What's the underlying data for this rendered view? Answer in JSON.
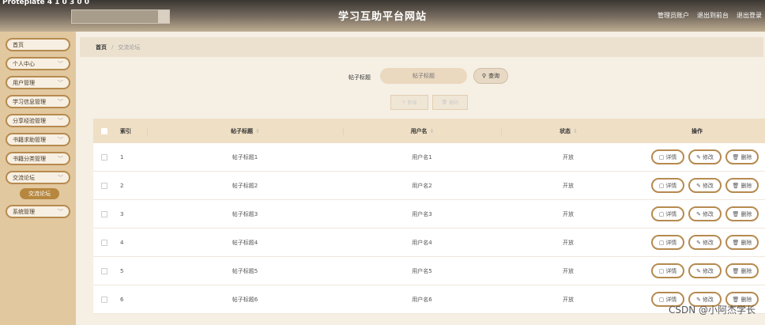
{
  "header": {
    "logo_text": "Proteplate 4 1 0 3 0 0",
    "site_title": "学习互助平台网站",
    "links": [
      "管理员账户",
      "退出到前台",
      "退出登录"
    ]
  },
  "sidebar": {
    "items": [
      {
        "label": "首页",
        "has_chevron": false
      },
      {
        "label": "个人中心",
        "has_chevron": true
      },
      {
        "label": "用户管理",
        "has_chevron": true
      },
      {
        "label": "学习信息管理",
        "has_chevron": true
      },
      {
        "label": "分享经验管理",
        "has_chevron": true
      },
      {
        "label": "书籍求助管理",
        "has_chevron": true
      },
      {
        "label": "书籍分类管理",
        "has_chevron": true
      },
      {
        "label": "交流论坛",
        "has_chevron": true
      },
      {
        "label": "系统管理",
        "has_chevron": true
      }
    ],
    "sub_item": "交流论坛"
  },
  "breadcrumb": {
    "home": "首页",
    "sep": "/",
    "current": "交流论坛"
  },
  "filter": {
    "label": "帖子标题",
    "placeholder": "帖子标题",
    "query_label": "查询",
    "add_label": "新增",
    "delete_label": "删除"
  },
  "table": {
    "headers": {
      "index": "索引",
      "title": "帖子标题",
      "user": "用户名",
      "status": "状态",
      "ops": "操作"
    },
    "ops": {
      "detail": "详情",
      "edit": "修改",
      "delete": "删除"
    },
    "rows": [
      {
        "index": "1",
        "title": "帖子标题1",
        "user": "用户名1",
        "status": "开放"
      },
      {
        "index": "2",
        "title": "帖子标题2",
        "user": "用户名2",
        "status": "开放"
      },
      {
        "index": "3",
        "title": "帖子标题3",
        "user": "用户名3",
        "status": "开放"
      },
      {
        "index": "4",
        "title": "帖子标题4",
        "user": "用户名4",
        "status": "开放"
      },
      {
        "index": "5",
        "title": "帖子标题5",
        "user": "用户名5",
        "status": "开放"
      },
      {
        "index": "6",
        "title": "帖子标题6",
        "user": "用户名6",
        "status": "开放"
      }
    ]
  },
  "watermark": "CSDN @小阿杰学长"
}
